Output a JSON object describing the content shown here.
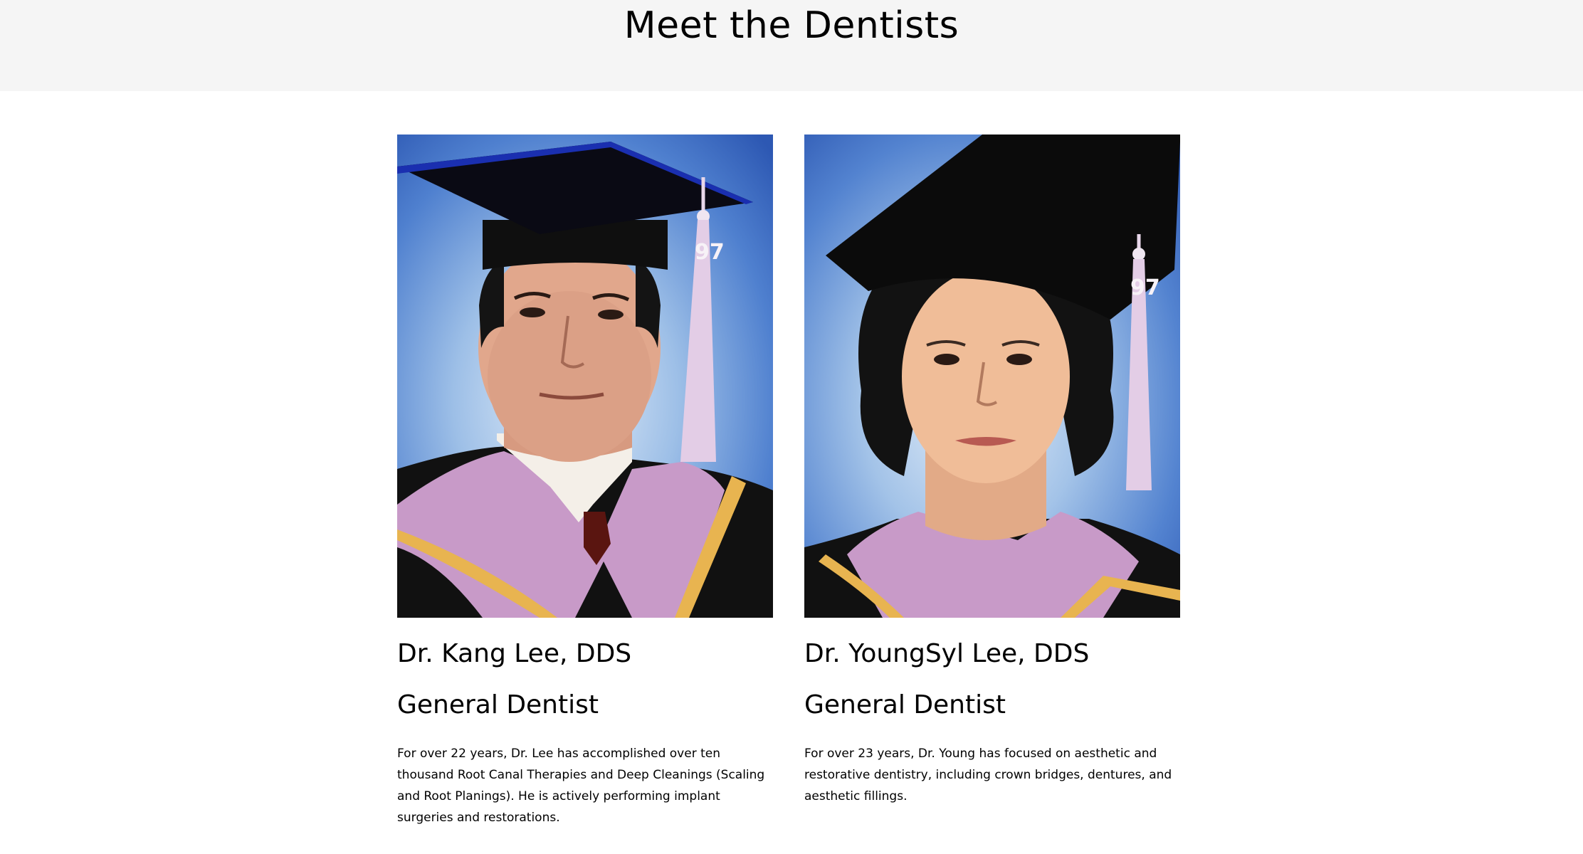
{
  "page": {
    "title": "Meet the Dentists"
  },
  "dentists": [
    {
      "name": "Dr. Kang Lee, DDS",
      "role": "General Dentist",
      "bio": "For over 22 years, Dr. Lee has accomplished over ten thousand Root Canal Therapies and Deep Cleanings (Scaling and Root Planings). He is actively performing implant surgeries and restorations.",
      "tassel_year": "97"
    },
    {
      "name": "Dr. YoungSyl Lee, DDS",
      "role": "General Dentist",
      "bio": "For over 23 years, Dr. Young has focused on aesthetic and restorative dentistry, including crown bridges, dentures, and aesthetic fillings.",
      "tassel_year": "97"
    }
  ],
  "colors": {
    "header_background": "#f5f5f5",
    "page_background": "#ffffff",
    "text": "#000000",
    "portrait_backdrop": "#4e80cf",
    "gown": "#111111",
    "hood_velvet": "#c89ac8",
    "hood_trim": "#e8b450"
  }
}
